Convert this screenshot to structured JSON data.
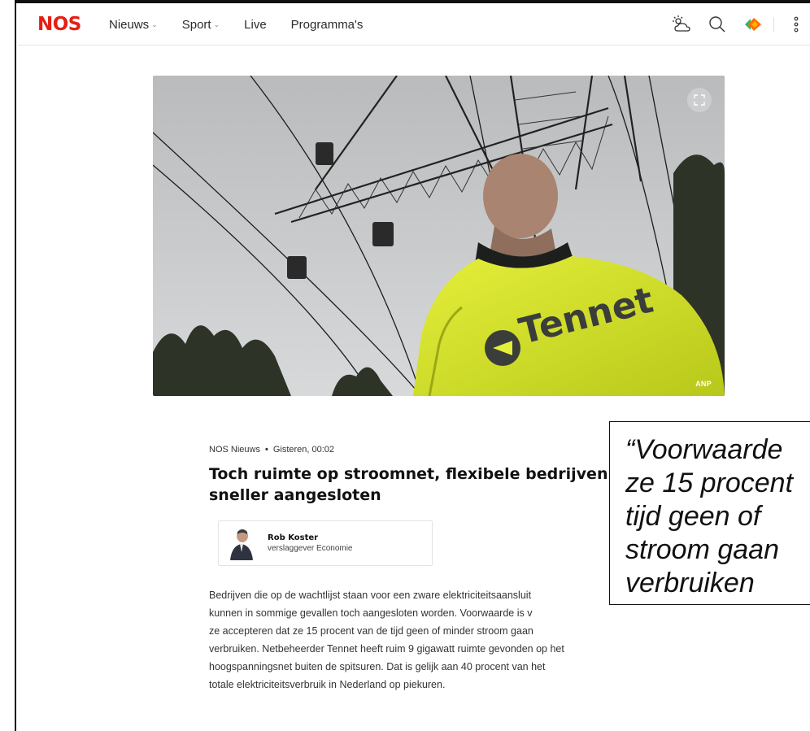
{
  "header": {
    "logo": "NOS",
    "nav": [
      {
        "label": "Nieuws",
        "has_dropdown": true
      },
      {
        "label": "Sport",
        "has_dropdown": true
      },
      {
        "label": "Live",
        "has_dropdown": false
      },
      {
        "label": "Programma's",
        "has_dropdown": false
      }
    ],
    "icons": [
      "weather-icon",
      "search-icon",
      "npo-start-icon",
      "more-menu-icon"
    ]
  },
  "hero": {
    "credit": "ANP",
    "jacket_text": "Tennet"
  },
  "article": {
    "source": "NOS Nieuws",
    "timestamp": "Gisteren, 00:02",
    "title_line1": "Toch ruimte op stroomnet, flexibele bedrijven",
    "title_line2": "sneller aangesloten",
    "author": {
      "name": "Rob Koster",
      "role": "verslaggever Economie"
    },
    "body_lines": [
      "Bedrijven die op de wachtlijst staan voor een zware elektriciteitsaansluit",
      "kunnen in sommige gevallen toch aangesloten worden. Voorwaarde is v",
      "ze accepteren dat ze 15 procent van de tijd geen of minder stroom gaan",
      "verbruiken. Netbeheerder Tennet heeft ruim 9 gigawatt ruimte gevonden op het",
      "hoogspanningsnet buiten de spitsuren. Dat is gelijk aan 40 procent van het",
      "totale elektriciteitsverbruik in Nederland op piekuren."
    ]
  },
  "quote": {
    "lines": [
      "“Voorwaarde",
      "ze 15 procent",
      "tijd geen of",
      "stroom gaan",
      "verbruiken"
    ]
  },
  "colors": {
    "brand_red": "#e61e14",
    "jacket_yellow": "#d6e62a",
    "npo_orange": "#ff6d00"
  }
}
